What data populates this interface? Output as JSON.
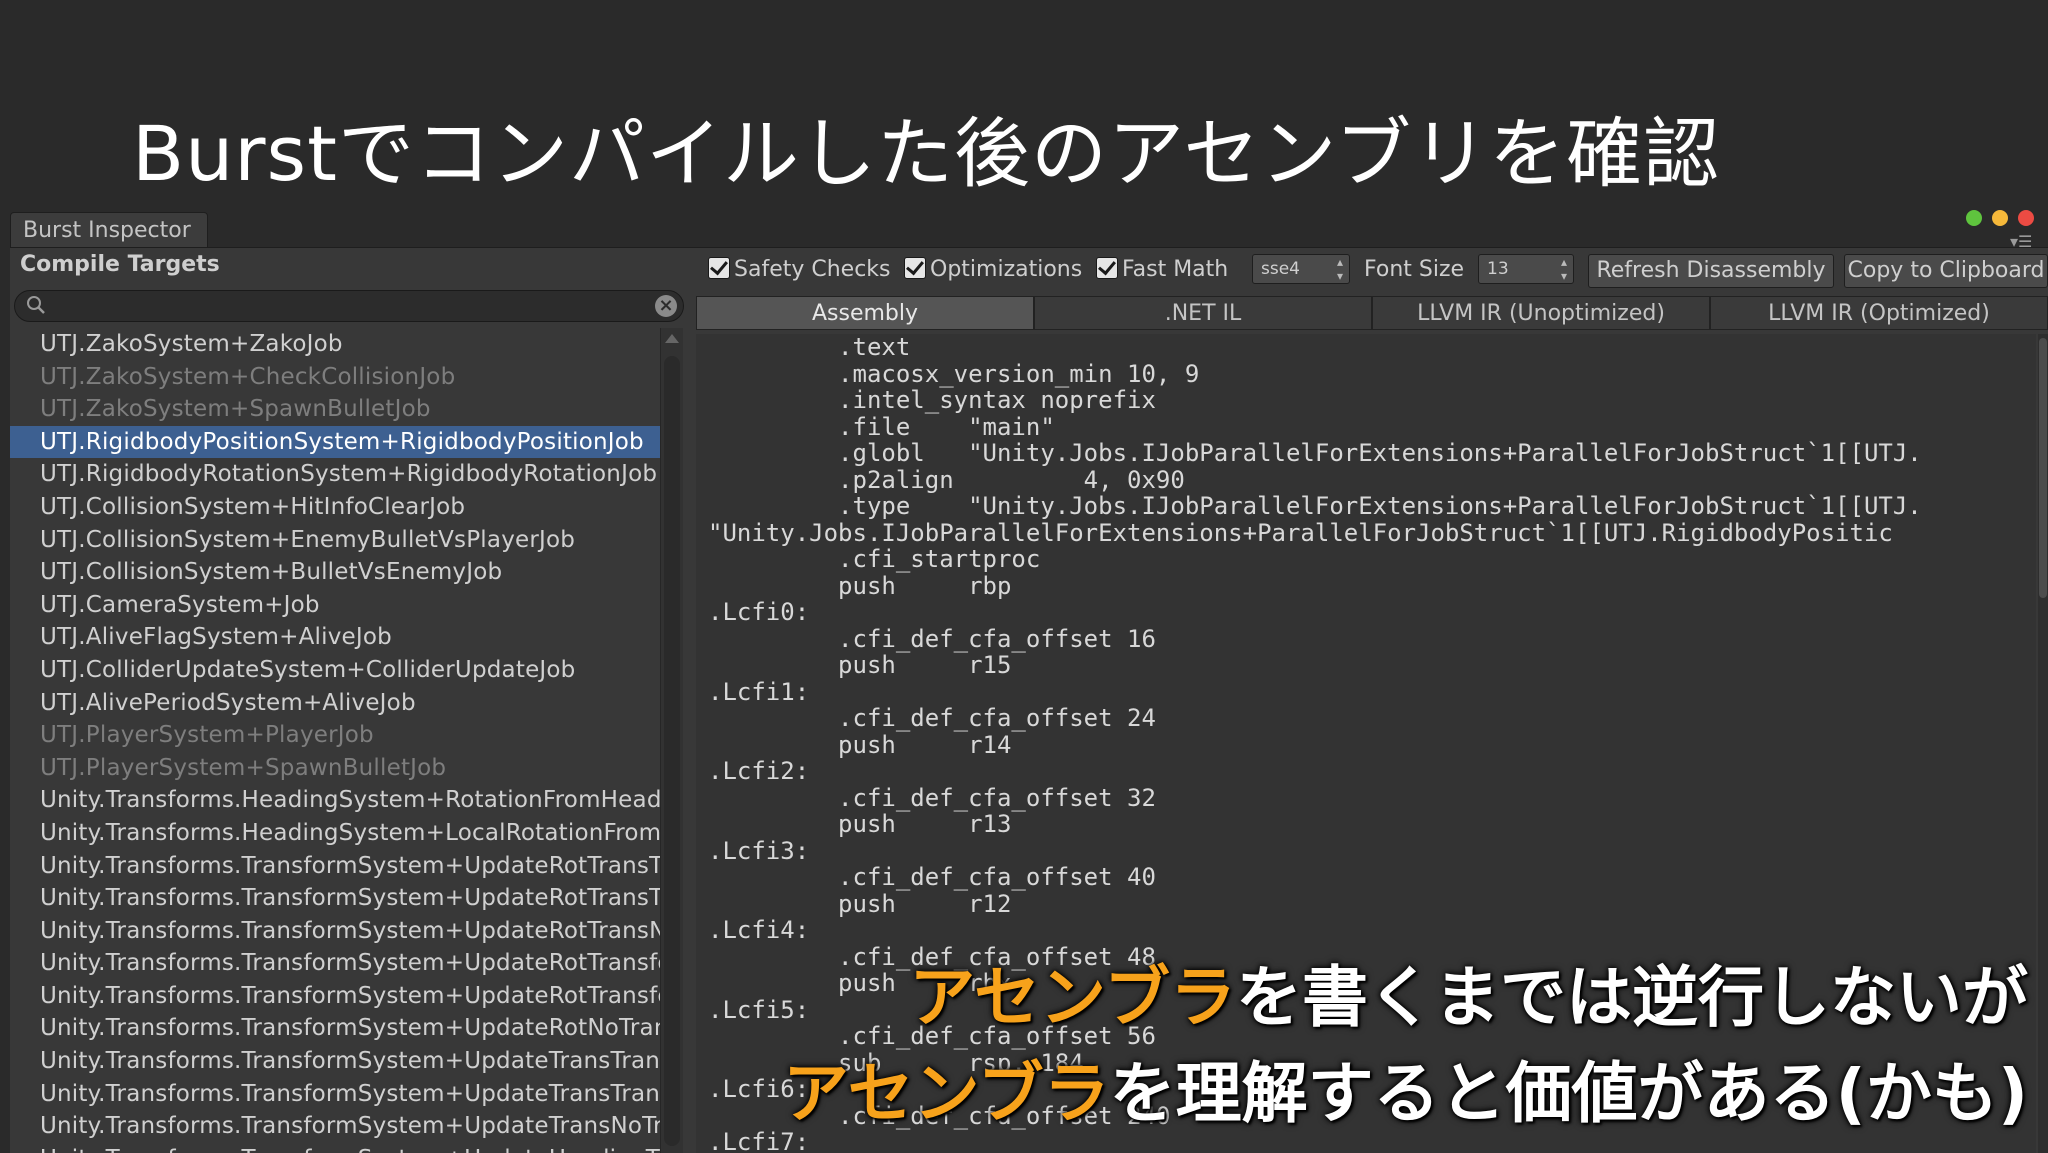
{
  "slide": {
    "title": "Burstでコンパイルした後のアセンブリを確認"
  },
  "window": {
    "tab_label": "Burst Inspector"
  },
  "compile_targets": {
    "header": "Compile Targets",
    "search_placeholder": "",
    "search_clear_glyph": "×",
    "items": [
      {
        "label": "UTJ.ZakoSystem+ZakoJob",
        "state": "normal"
      },
      {
        "label": "UTJ.ZakoSystem+CheckCollisionJob",
        "state": "disabled"
      },
      {
        "label": "UTJ.ZakoSystem+SpawnBulletJob",
        "state": "disabled"
      },
      {
        "label": "UTJ.RigidbodyPositionSystem+RigidbodyPositionJob",
        "state": "selected"
      },
      {
        "label": "UTJ.RigidbodyRotationSystem+RigidbodyRotationJob",
        "state": "normal"
      },
      {
        "label": "UTJ.CollisionSystem+HitInfoClearJob",
        "state": "normal"
      },
      {
        "label": "UTJ.CollisionSystem+EnemyBulletVsPlayerJob",
        "state": "normal"
      },
      {
        "label": "UTJ.CollisionSystem+BulletVsEnemyJob",
        "state": "normal"
      },
      {
        "label": "UTJ.CameraSystem+Job",
        "state": "normal"
      },
      {
        "label": "UTJ.AliveFlagSystem+AliveJob",
        "state": "normal"
      },
      {
        "label": "UTJ.ColliderUpdateSystem+ColliderUpdateJob",
        "state": "normal"
      },
      {
        "label": "UTJ.AlivePeriodSystem+AliveJob",
        "state": "normal"
      },
      {
        "label": "UTJ.PlayerSystem+PlayerJob",
        "state": "disabled"
      },
      {
        "label": "UTJ.PlayerSystem+SpawnBulletJob",
        "state": "disabled"
      },
      {
        "label": "Unity.Transforms.HeadingSystem+RotationFromHeading",
        "state": "normal"
      },
      {
        "label": "Unity.Transforms.HeadingSystem+LocalRotationFromLo",
        "state": "normal"
      },
      {
        "label": "Unity.Transforms.TransformSystem+UpdateRotTransTra",
        "state": "normal"
      },
      {
        "label": "Unity.Transforms.TransformSystem+UpdateRotTransTra",
        "state": "normal"
      },
      {
        "label": "Unity.Transforms.TransformSystem+UpdateRotTransNo",
        "state": "normal"
      },
      {
        "label": "Unity.Transforms.TransformSystem+UpdateRotTransfor",
        "state": "normal"
      },
      {
        "label": "Unity.Transforms.TransformSystem+UpdateRotTransfor",
        "state": "normal"
      },
      {
        "label": "Unity.Transforms.TransformSystem+UpdateRotNoTransf",
        "state": "normal"
      },
      {
        "label": "Unity.Transforms.TransformSystem+UpdateTransTransf",
        "state": "normal"
      },
      {
        "label": "Unity.Transforms.TransformSystem+UpdateTransTransf",
        "state": "normal"
      },
      {
        "label": "Unity.Transforms.TransformSystem+UpdateTransNoTran",
        "state": "normal"
      },
      {
        "label": "Unity.Transforms.TransformSystem+UpdateHeadingTran",
        "state": "normal"
      }
    ]
  },
  "toolbar": {
    "safety_checks": "Safety Checks",
    "optimizations": "Optimizations",
    "fast_math": "Fast Math",
    "target_value": "sse4",
    "font_size_label": "Font Size",
    "font_size_value": "13",
    "refresh_button": "Refresh Disassembly",
    "copy_button": "Copy to Clipboard"
  },
  "ir_tabs": [
    "Assembly",
    ".NET IL",
    "LLVM IR (Unoptimized)",
    "LLVM IR (Optimized)"
  ],
  "asm_lines": [
    "         .text",
    "         .macosx_version_min 10, 9",
    "         .intel_syntax noprefix",
    "         .file    \"main\"",
    "         .globl   \"Unity.Jobs.IJobParallelForExtensions+ParallelForJobStruct`1[[UTJ.",
    "         .p2align         4, 0x90",
    "         .type    \"Unity.Jobs.IJobParallelForExtensions+ParallelForJobStruct`1[[UTJ.",
    "\"Unity.Jobs.IJobParallelForExtensions+ParallelForJobStruct`1[[UTJ.RigidbodyPositic",
    "         .cfi_startproc",
    "         push     rbp",
    ".Lcfi0:",
    "         .cfi_def_cfa_offset 16",
    "         push     r15",
    ".Lcfi1:",
    "         .cfi_def_cfa_offset 24",
    "         push     r14",
    ".Lcfi2:",
    "         .cfi_def_cfa_offset 32",
    "         push     r13",
    ".Lcfi3:",
    "         .cfi_def_cfa_offset 40",
    "         push     r12",
    ".Lcfi4:",
    "         .cfi_def_cfa_offset 48",
    "         push     rbx",
    ".Lcfi5:",
    "         .cfi_def_cfa_offset 56",
    "         sub      rsp, 184",
    ".Lcfi6:",
    "         .cfi_def_cfa_offset 240",
    ".Lcfi7:"
  ],
  "captions": {
    "line1_accent": "アセンブラ",
    "line1_rest": "を書くまでは逆行しないが",
    "line2_accent": "アセンブラ",
    "line2_rest": "を理解すると価値がある(かも)"
  },
  "colors": {
    "caption_accent": "#f7a21b",
    "selection": "#3d6091",
    "background": "#2a2a2a"
  }
}
